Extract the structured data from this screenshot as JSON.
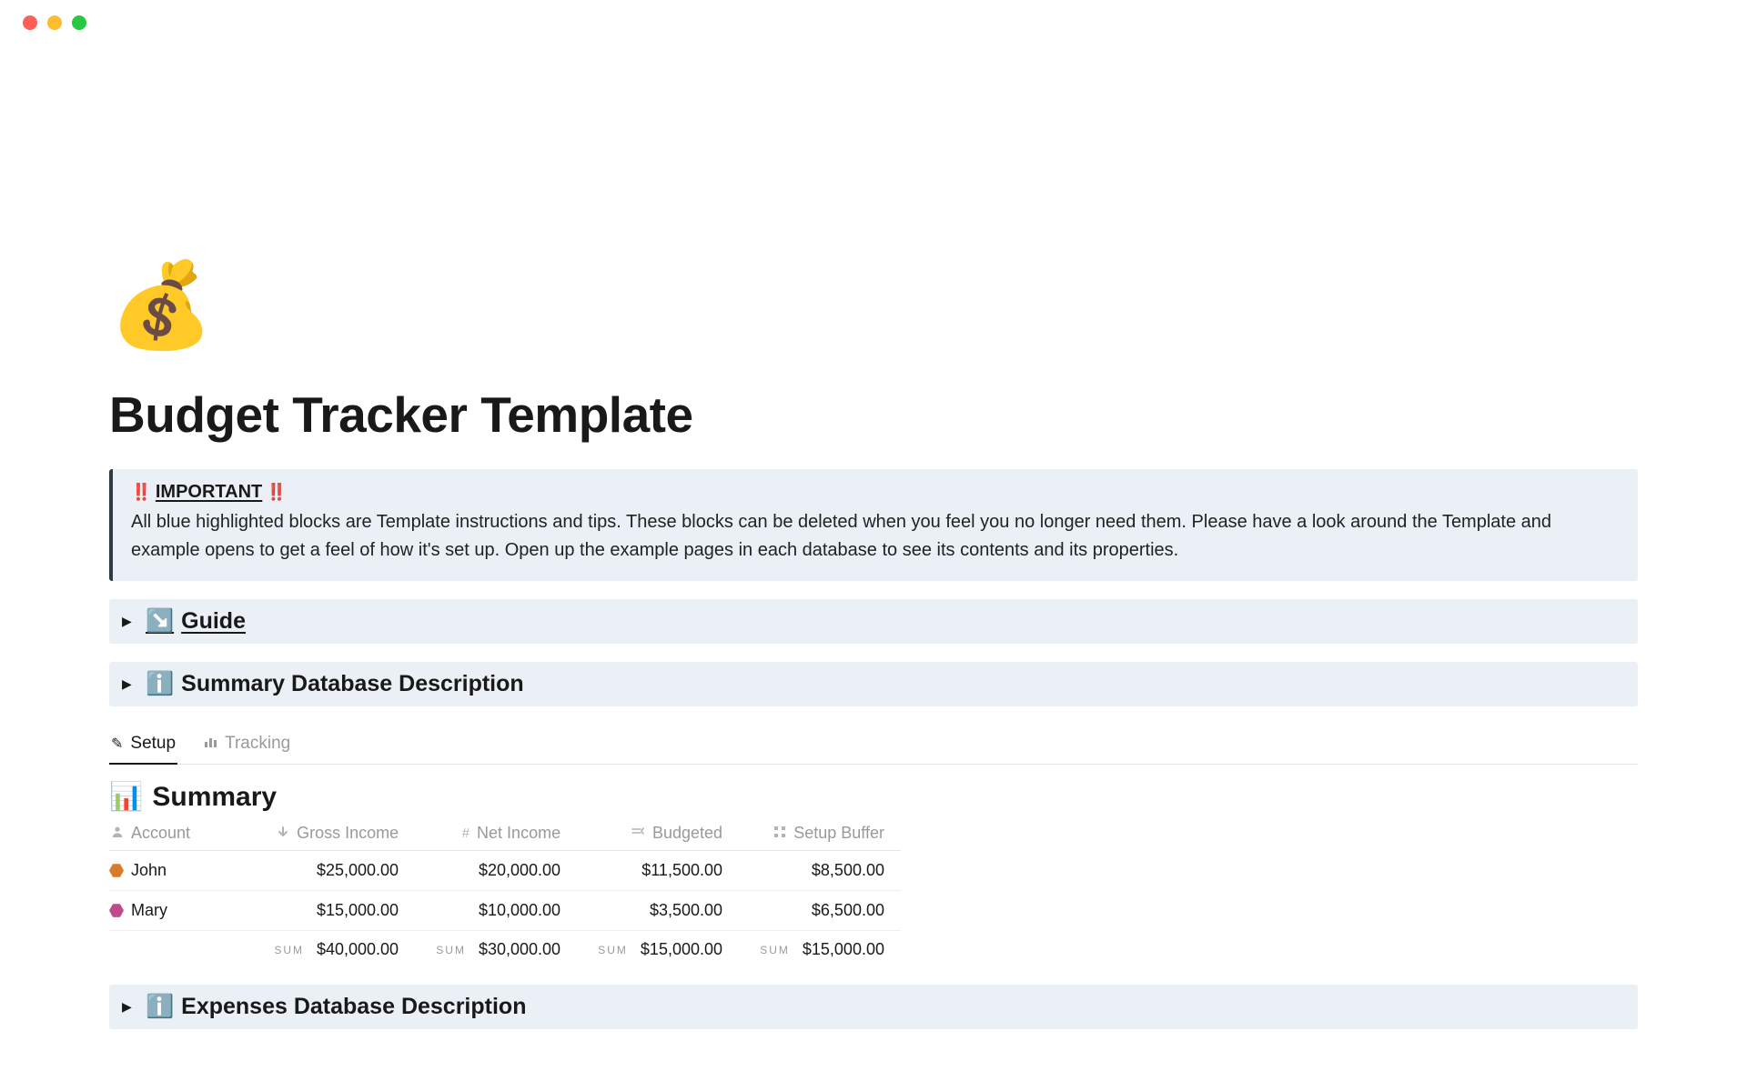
{
  "page": {
    "icon": "💰",
    "title": "Budget Tracker Template"
  },
  "callout": {
    "warn_emoji": "‼️",
    "title": "IMPORTANT",
    "body": "All blue highlighted blocks are Template instructions and tips. These blocks can be deleted when you feel you no longer need them. Please have a look around the Template and example opens to get a feel of how it's set up. Open up the example pages in each database to see its contents and its properties."
  },
  "toggles": {
    "guide": {
      "icon": "↘️",
      "label": "Guide"
    },
    "summary_desc": {
      "icon": "ℹ️",
      "label": "Summary Database Description"
    },
    "expenses_desc": {
      "icon": "ℹ️",
      "label": "Expenses Database Description"
    }
  },
  "tabs": {
    "setup": {
      "icon": "✏️",
      "label": "Setup"
    },
    "tracking": {
      "icon": "📊",
      "label": "Tracking"
    }
  },
  "summary": {
    "icon": "📊",
    "title": "Summary",
    "headers": {
      "account": "Account",
      "gross": "Gross Income",
      "net": "Net Income",
      "budgeted": "Budgeted",
      "buffer": "Setup Buffer"
    },
    "header_icons": {
      "account": "person",
      "gross": "arrow-down",
      "net": "hash",
      "budgeted": "formula",
      "buffer": "grid"
    },
    "rows": [
      {
        "name": "John",
        "gross": "$25,000.00",
        "net": "$20,000.00",
        "budgeted": "$11,500.00",
        "buffer": "$8,500.00",
        "color": "orange"
      },
      {
        "name": "Mary",
        "gross": "$15,000.00",
        "net": "$10,000.00",
        "budgeted": "$3,500.00",
        "buffer": "$6,500.00",
        "color": "magenta"
      }
    ],
    "sum_label": "SUM",
    "sums": {
      "gross": "$40,000.00",
      "net": "$30,000.00",
      "budgeted": "$15,000.00",
      "buffer": "$15,000.00"
    }
  }
}
